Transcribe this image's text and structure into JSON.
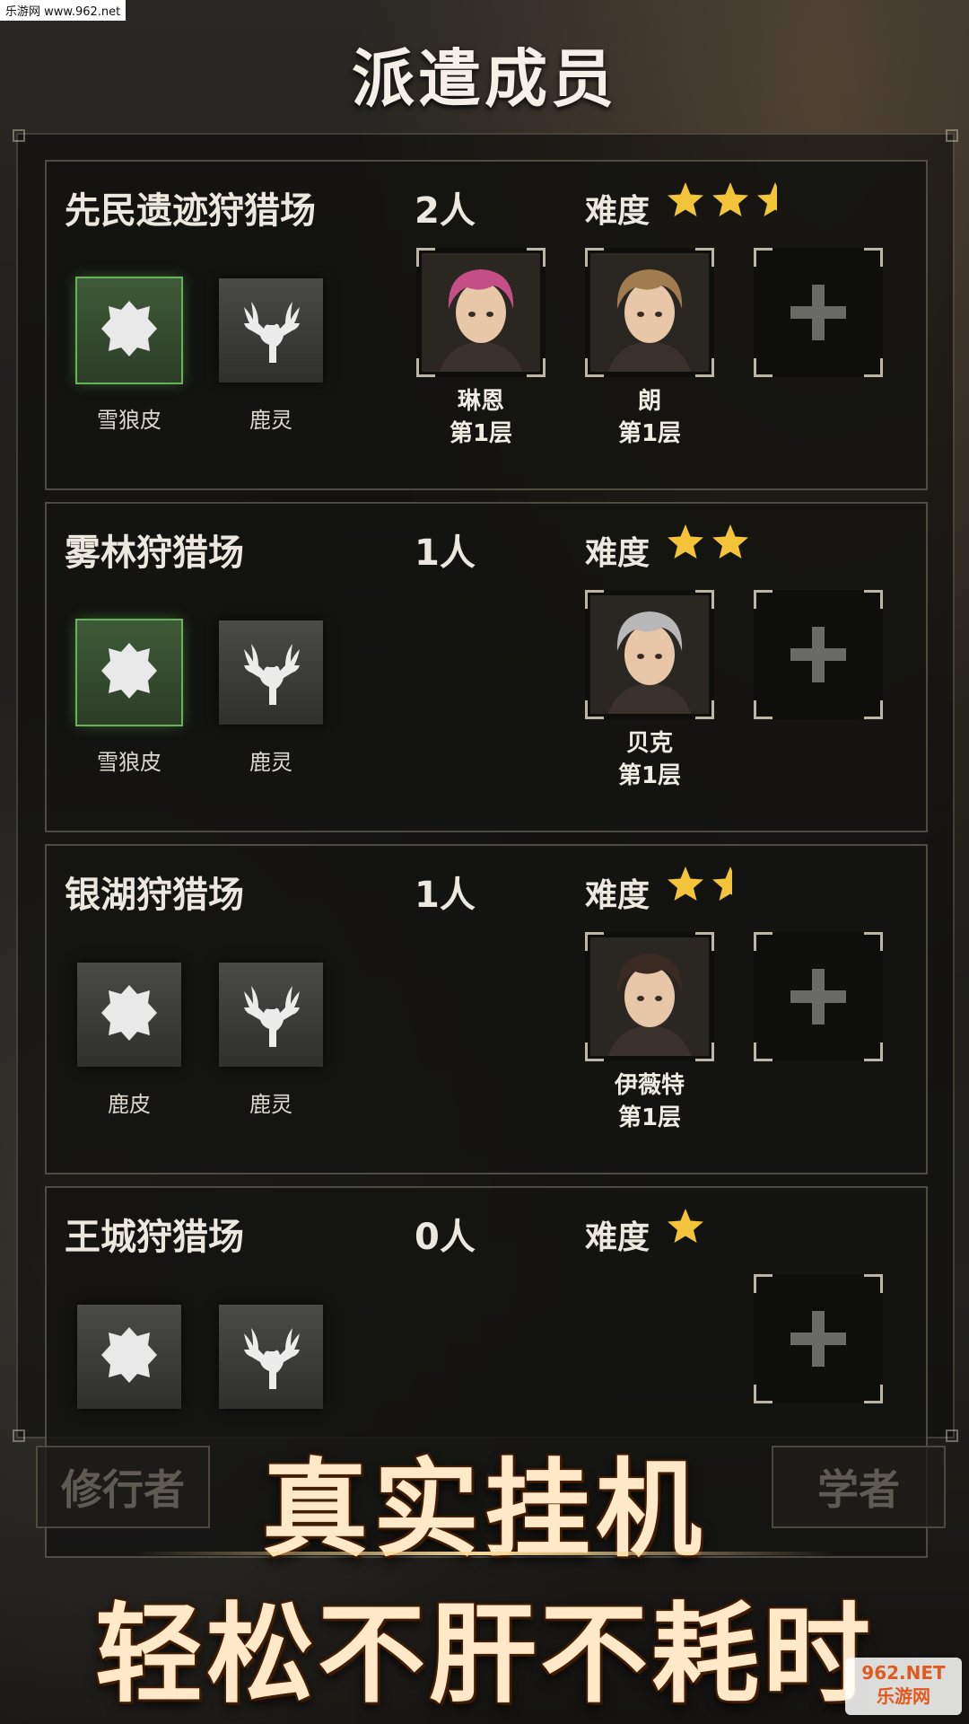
{
  "watermark_top": "乐游网 www.962.net",
  "title": "派遣成员",
  "colors": {
    "star": "#f3c43a",
    "green_border": "#6bb05c",
    "slogan": "#ffe9c8"
  },
  "grounds": [
    {
      "name": "先民遗迹狩猎场",
      "count": "2人",
      "difficulty_label": "难度",
      "stars": 2.5,
      "items": [
        {
          "label": "雪狼皮",
          "icon": "pelt-icon",
          "highlight": true
        },
        {
          "label": "鹿灵",
          "icon": "deer-icon",
          "highlight": false
        }
      ],
      "members": [
        {
          "name": "琳恩",
          "level": "第1层",
          "hair": "#c44f86"
        },
        {
          "name": "朗",
          "level": "第1层",
          "hair": "#a07c4e"
        }
      ]
    },
    {
      "name": "雾林狩猎场",
      "count": "1人",
      "difficulty_label": "难度",
      "stars": 2,
      "items": [
        {
          "label": "雪狼皮",
          "icon": "pelt-icon",
          "highlight": true
        },
        {
          "label": "鹿灵",
          "icon": "deer-icon",
          "highlight": false
        }
      ],
      "members": [
        {
          "name": "贝克",
          "level": "第1层",
          "hair": "#b8b8b8"
        }
      ]
    },
    {
      "name": "银湖狩猎场",
      "count": "1人",
      "difficulty_label": "难度",
      "stars": 1.5,
      "items": [
        {
          "label": "鹿皮",
          "icon": "pelt-icon",
          "highlight": false
        },
        {
          "label": "鹿灵",
          "icon": "deer-icon",
          "highlight": false
        }
      ],
      "members": [
        {
          "name": "伊薇特",
          "level": "第1层",
          "hair": "#3a2a22"
        }
      ]
    },
    {
      "name": "王城狩猎场",
      "count": "0人",
      "difficulty_label": "难度",
      "stars": 1,
      "items": [
        {
          "label": "",
          "icon": "pelt-icon",
          "highlight": false
        },
        {
          "label": "",
          "icon": "deer-icon",
          "highlight": false
        }
      ],
      "members": []
    }
  ],
  "tabs": [
    "修行者",
    "学者"
  ],
  "slogan": {
    "line1": "真实挂机",
    "line2": "轻松不肝不耗时"
  },
  "watermark_bottom": {
    "line1": "962.NET",
    "line2": "乐游网"
  }
}
